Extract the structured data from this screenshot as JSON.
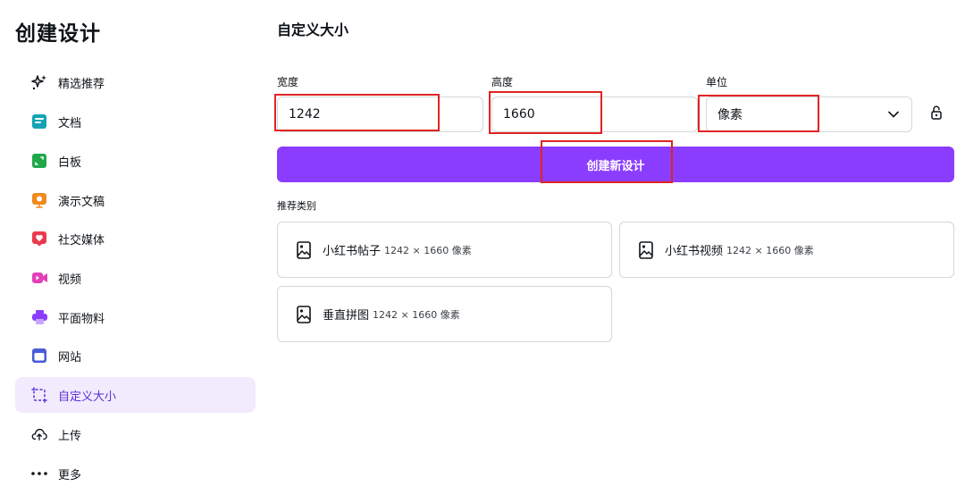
{
  "sidebar": {
    "title": "创建设计",
    "items": [
      {
        "label": "精选推荐",
        "icon": "sparkle-icon"
      },
      {
        "label": "文档",
        "icon": "document-icon"
      },
      {
        "label": "白板",
        "icon": "whiteboard-icon"
      },
      {
        "label": "演示文稿",
        "icon": "presentation-icon"
      },
      {
        "label": "社交媒体",
        "icon": "heart-icon"
      },
      {
        "label": "视频",
        "icon": "video-icon"
      },
      {
        "label": "平面物料",
        "icon": "printer-icon"
      },
      {
        "label": "网站",
        "icon": "website-icon"
      },
      {
        "label": "自定义大小",
        "icon": "custom-size-icon"
      },
      {
        "label": "上传",
        "icon": "cloud-upload-icon"
      },
      {
        "label": "更多",
        "icon": "more-icon"
      }
    ],
    "active_index": 8
  },
  "main": {
    "title": "自定义大小",
    "width": {
      "label": "宽度",
      "value": "1242"
    },
    "height": {
      "label": "高度",
      "value": "1660"
    },
    "unit": {
      "label": "单位",
      "value": "像素"
    },
    "create_button": "创建新设计",
    "section_label": "推荐类别",
    "cards": [
      {
        "name": "小红书帖子",
        "dims": "1242 × 1660 像素"
      },
      {
        "name": "小红书视频",
        "dims": "1242 × 1660 像素"
      },
      {
        "name": "垂直拼图",
        "dims": "1242 × 1660 像素"
      }
    ]
  },
  "colors": {
    "accent": "#8b3dff",
    "active_bg": "#f1ebfd",
    "highlight": "#e02424"
  }
}
